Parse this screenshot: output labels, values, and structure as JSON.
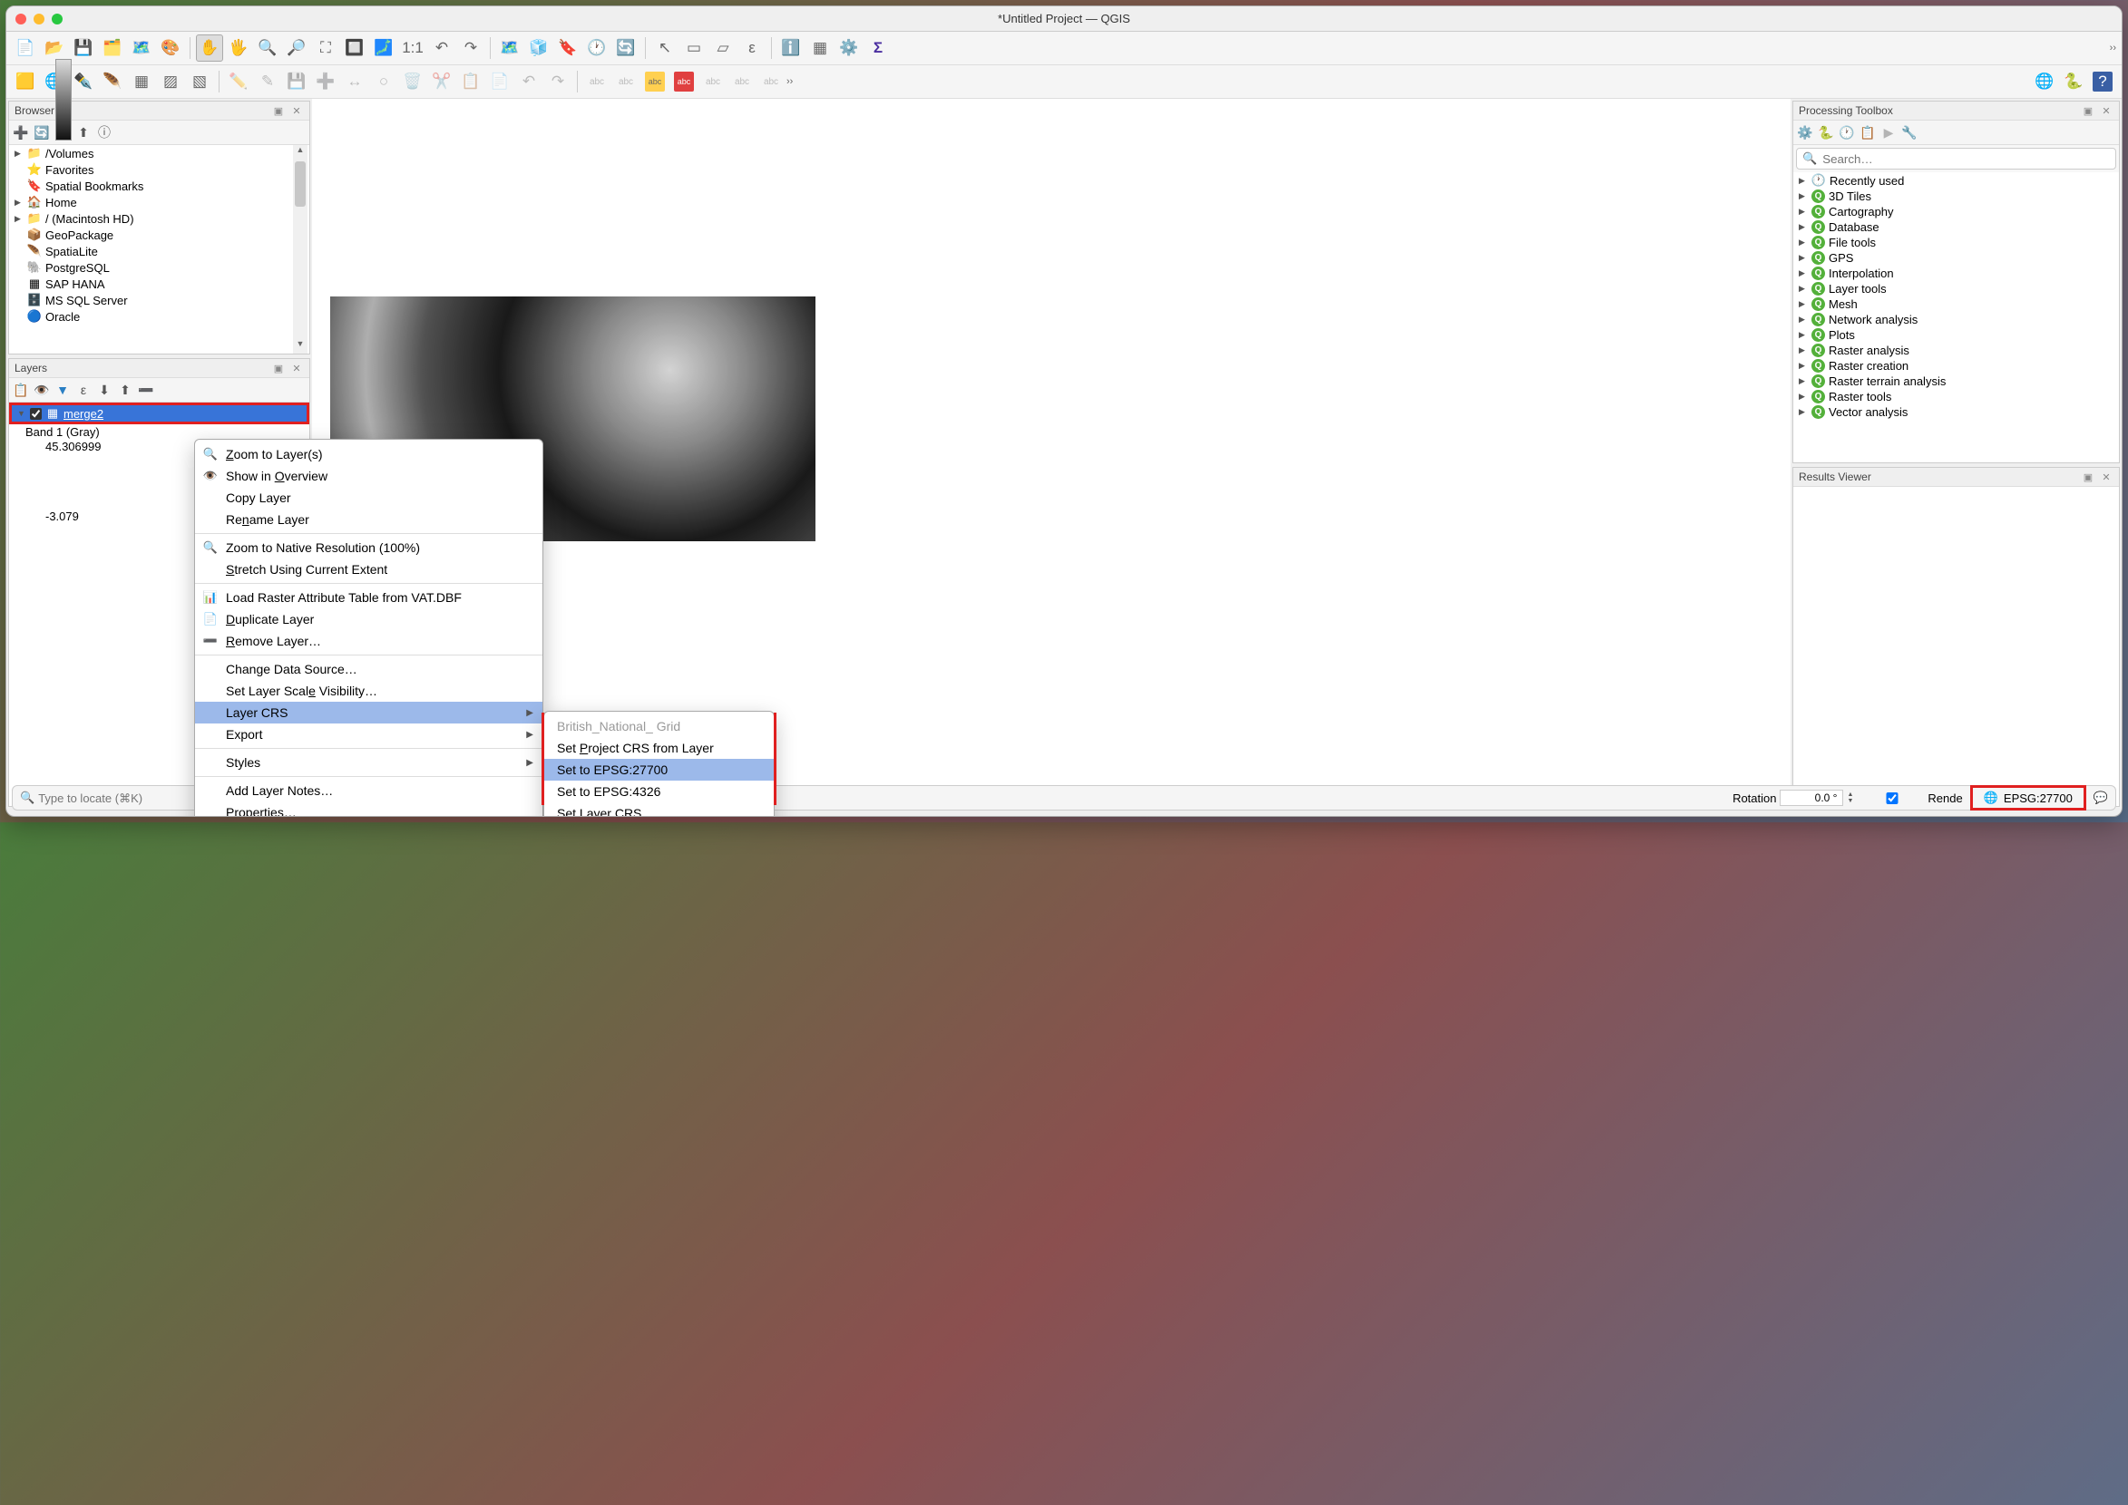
{
  "window": {
    "title": "*Untitled Project — QGIS"
  },
  "browser": {
    "title": "Browser",
    "items": [
      {
        "icon": "folder",
        "label": "/Volumes",
        "expandable": true
      },
      {
        "icon": "star",
        "label": "Favorites"
      },
      {
        "icon": "bookmark",
        "label": "Spatial Bookmarks"
      },
      {
        "icon": "home",
        "label": "Home",
        "expandable": true
      },
      {
        "icon": "folder",
        "label": "/ (Macintosh HD)",
        "expandable": true
      },
      {
        "icon": "geopkg",
        "label": "GeoPackage"
      },
      {
        "icon": "feather",
        "label": "SpatiaLite"
      },
      {
        "icon": "elephant",
        "label": "PostgreSQL"
      },
      {
        "icon": "sap",
        "label": "SAP HANA"
      },
      {
        "icon": "mssql",
        "label": "MS SQL Server"
      },
      {
        "icon": "oracle",
        "label": "Oracle"
      }
    ]
  },
  "layers": {
    "title": "Layers",
    "selected_layer": "merge2",
    "band_label": "Band 1 (Gray)",
    "max_value": "45.306999",
    "min_value": "-3.079"
  },
  "context_menu": {
    "items": [
      {
        "icon": "zoom",
        "label": "Zoom to Layer(s)",
        "u": [
          0
        ]
      },
      {
        "icon": "overview",
        "label": "Show in Overview",
        "u": [
          8
        ]
      },
      {
        "label": "Copy Layer"
      },
      {
        "label": "Rename Layer",
        "u": [
          2
        ]
      },
      {
        "sep": true
      },
      {
        "icon": "zoom",
        "label": "Zoom to Native Resolution (100%)"
      },
      {
        "label": "Stretch Using Current Extent",
        "u": [
          0
        ]
      },
      {
        "sep": true
      },
      {
        "icon": "table",
        "label": "Load Raster Attribute Table from VAT.DBF"
      },
      {
        "icon": "dup",
        "label": "Duplicate Layer",
        "u": [
          0
        ]
      },
      {
        "icon": "remove",
        "label": "Remove Layer…",
        "u": [
          0
        ]
      },
      {
        "sep": true
      },
      {
        "label": "Change Data Source…"
      },
      {
        "label": "Set Layer Scale Visibility…",
        "u": [
          14
        ]
      },
      {
        "label": "Layer CRS",
        "submenu": true,
        "hl": true
      },
      {
        "label": "Export",
        "submenu": true
      },
      {
        "sep": true
      },
      {
        "label": "Styles",
        "submenu": true
      },
      {
        "sep": true
      },
      {
        "label": "Add Layer Notes…"
      },
      {
        "label": "Properties…",
        "u": [
          0
        ]
      }
    ]
  },
  "submenu": {
    "items": [
      {
        "label": "British_National_ Grid",
        "disabled": true
      },
      {
        "label": "Set Project CRS from Layer",
        "u": [
          4
        ]
      },
      {
        "label": "Set to EPSG:27700",
        "hl": true
      },
      {
        "label": "Set to EPSG:4326"
      },
      {
        "label": "Set Layer CRS…",
        "u": [
          4
        ]
      }
    ]
  },
  "processing": {
    "title": "Processing Toolbox",
    "search_placeholder": "Search…",
    "groups": [
      {
        "icon": "clock",
        "label": "Recently used"
      },
      {
        "icon": "q",
        "label": "3D Tiles"
      },
      {
        "icon": "q",
        "label": "Cartography"
      },
      {
        "icon": "q",
        "label": "Database"
      },
      {
        "icon": "q",
        "label": "File tools"
      },
      {
        "icon": "q",
        "label": "GPS"
      },
      {
        "icon": "q",
        "label": "Interpolation"
      },
      {
        "icon": "q",
        "label": "Layer tools"
      },
      {
        "icon": "q",
        "label": "Mesh"
      },
      {
        "icon": "q",
        "label": "Network analysis"
      },
      {
        "icon": "q",
        "label": "Plots"
      },
      {
        "icon": "q",
        "label": "Raster analysis"
      },
      {
        "icon": "q",
        "label": "Raster creation"
      },
      {
        "icon": "q",
        "label": "Raster terrain analysis"
      },
      {
        "icon": "q",
        "label": "Raster tools"
      },
      {
        "icon": "q",
        "label": "Vector analysis"
      }
    ]
  },
  "results_viewer": {
    "title": "Results Viewer"
  },
  "status": {
    "locator_placeholder": "Type to locate (⌘K)",
    "rotation_label": "Rotation",
    "rotation_value": "0.0 °",
    "render_label": "Rende",
    "crs": "EPSG:27700"
  }
}
